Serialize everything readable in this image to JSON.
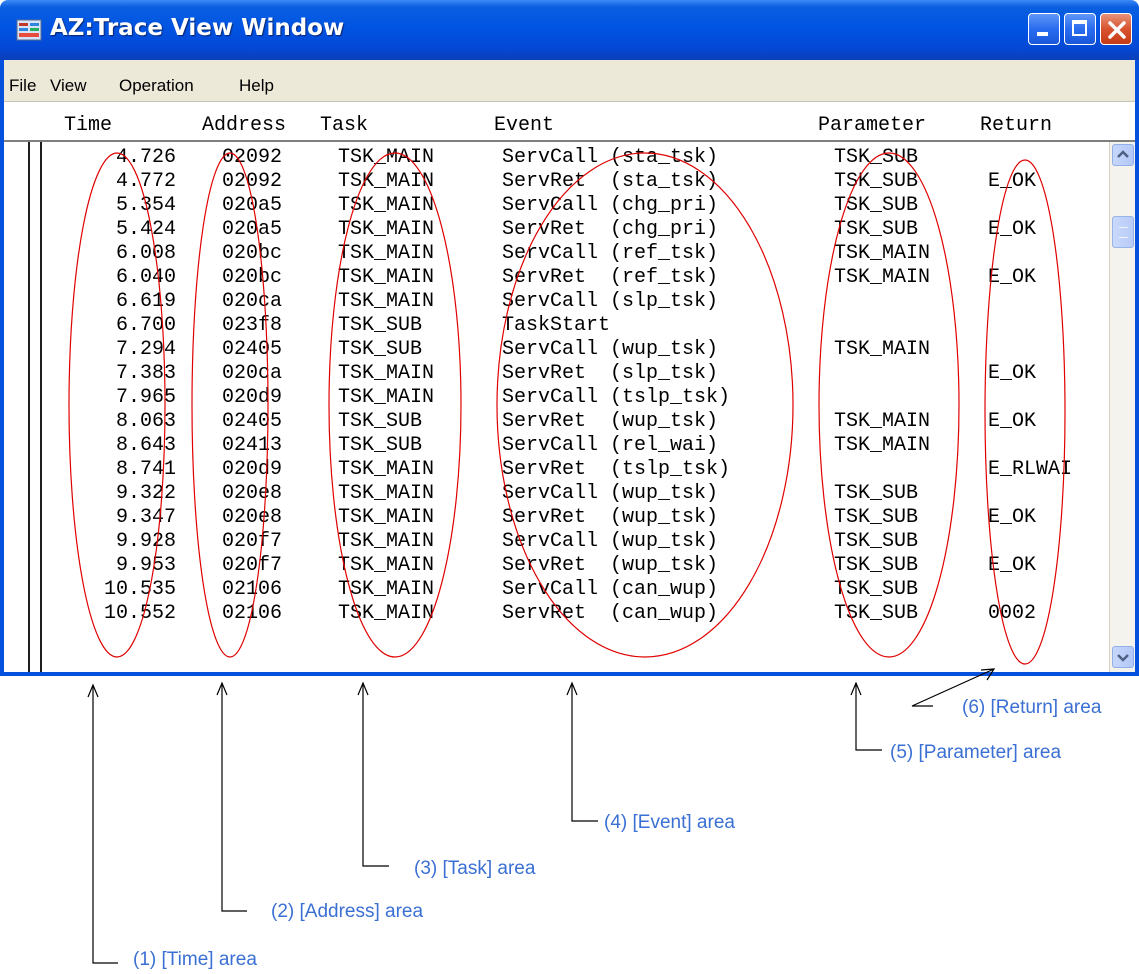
{
  "window": {
    "title": "AZ:Trace View Window",
    "icon": "app-trace-icon",
    "controls": [
      "minimize-icon",
      "maximize-icon",
      "close-icon"
    ]
  },
  "menu": {
    "file": "File",
    "view": "View",
    "operation": "Operation",
    "help": "Help"
  },
  "columns": {
    "time": "Time",
    "address": "Address",
    "task": "Task",
    "event": "Event",
    "parameter": "Parameter",
    "return": "Return"
  },
  "rows": [
    {
      "time": "4.726",
      "address": "02092",
      "task": "TSK_MAIN",
      "event": "ServCall (sta_tsk)",
      "parameter": "TSK_SUB",
      "return": ""
    },
    {
      "time": "4.772",
      "address": "02092",
      "task": "TSK_MAIN",
      "event": "ServRet  (sta_tsk)",
      "parameter": "TSK_SUB",
      "return": "E_OK"
    },
    {
      "time": "5.354",
      "address": "020a5",
      "task": "TSK_MAIN",
      "event": "ServCall (chg_pri)",
      "parameter": "TSK_SUB",
      "return": ""
    },
    {
      "time": "5.424",
      "address": "020a5",
      "task": "TSK_MAIN",
      "event": "ServRet  (chg_pri)",
      "parameter": "TSK_SUB",
      "return": "E_OK"
    },
    {
      "time": "6.008",
      "address": "020bc",
      "task": "TSK_MAIN",
      "event": "ServCall (ref_tsk)",
      "parameter": "TSK_MAIN",
      "return": ""
    },
    {
      "time": "6.040",
      "address": "020bc",
      "task": "TSK_MAIN",
      "event": "ServRet  (ref_tsk)",
      "parameter": "TSK_MAIN",
      "return": "E_OK"
    },
    {
      "time": "6.619",
      "address": "020ca",
      "task": "TSK_MAIN",
      "event": "ServCall (slp_tsk)",
      "parameter": "",
      "return": ""
    },
    {
      "time": "6.700",
      "address": "023f8",
      "task": "TSK_SUB",
      "event": "TaskStart",
      "parameter": "",
      "return": ""
    },
    {
      "time": "7.294",
      "address": "02405",
      "task": "TSK_SUB",
      "event": "ServCall (wup_tsk)",
      "parameter": "TSK_MAIN",
      "return": ""
    },
    {
      "time": "7.383",
      "address": "020ca",
      "task": "TSK_MAIN",
      "event": "ServRet  (slp_tsk)",
      "parameter": "",
      "return": "E_OK"
    },
    {
      "time": "7.965",
      "address": "020d9",
      "task": "TSK_MAIN",
      "event": "ServCall (tslp_tsk)",
      "parameter": "",
      "return": ""
    },
    {
      "time": "8.063",
      "address": "02405",
      "task": "TSK_SUB",
      "event": "ServRet  (wup_tsk)",
      "parameter": "TSK_MAIN",
      "return": "E_OK"
    },
    {
      "time": "8.643",
      "address": "02413",
      "task": "TSK_SUB",
      "event": "ServCall (rel_wai)",
      "parameter": "TSK_MAIN",
      "return": ""
    },
    {
      "time": "8.741",
      "address": "020d9",
      "task": "TSK_MAIN",
      "event": "ServRet  (tslp_tsk)",
      "parameter": "",
      "return": "E_RLWAI"
    },
    {
      "time": "9.322",
      "address": "020e8",
      "task": "TSK_MAIN",
      "event": "ServCall (wup_tsk)",
      "parameter": "TSK_SUB",
      "return": ""
    },
    {
      "time": "9.347",
      "address": "020e8",
      "task": "TSK_MAIN",
      "event": "ServRet  (wup_tsk)",
      "parameter": "TSK_SUB",
      "return": "E_OK"
    },
    {
      "time": "9.928",
      "address": "020f7",
      "task": "TSK_MAIN",
      "event": "ServCall (wup_tsk)",
      "parameter": "TSK_SUB",
      "return": ""
    },
    {
      "time": "9.953",
      "address": "020f7",
      "task": "TSK_MAIN",
      "event": "ServRet  (wup_tsk)",
      "parameter": "TSK_SUB",
      "return": "E_OK"
    },
    {
      "time": "10.535",
      "address": "02106",
      "task": "TSK_MAIN",
      "event": "ServCall (can_wup)",
      "parameter": "TSK_SUB",
      "return": ""
    },
    {
      "time": "10.552",
      "address": "02106",
      "task": "TSK_MAIN",
      "event": "ServRet  (can_wup)",
      "parameter": "TSK_SUB",
      "return": "0002"
    }
  ],
  "annotations": {
    "time": "(1) [Time] area",
    "address": "(2) [Address] area",
    "task": "(3) [Task] area",
    "event": "(4) [Event] area",
    "parameter": "(5) [Parameter] area",
    "return": "(6) [Return] area"
  },
  "colors": {
    "titlebar": "#0054e3",
    "annotation_text": "#3a6fd4",
    "callout_ellipse": "#e00000",
    "callout_line": "#000000"
  }
}
